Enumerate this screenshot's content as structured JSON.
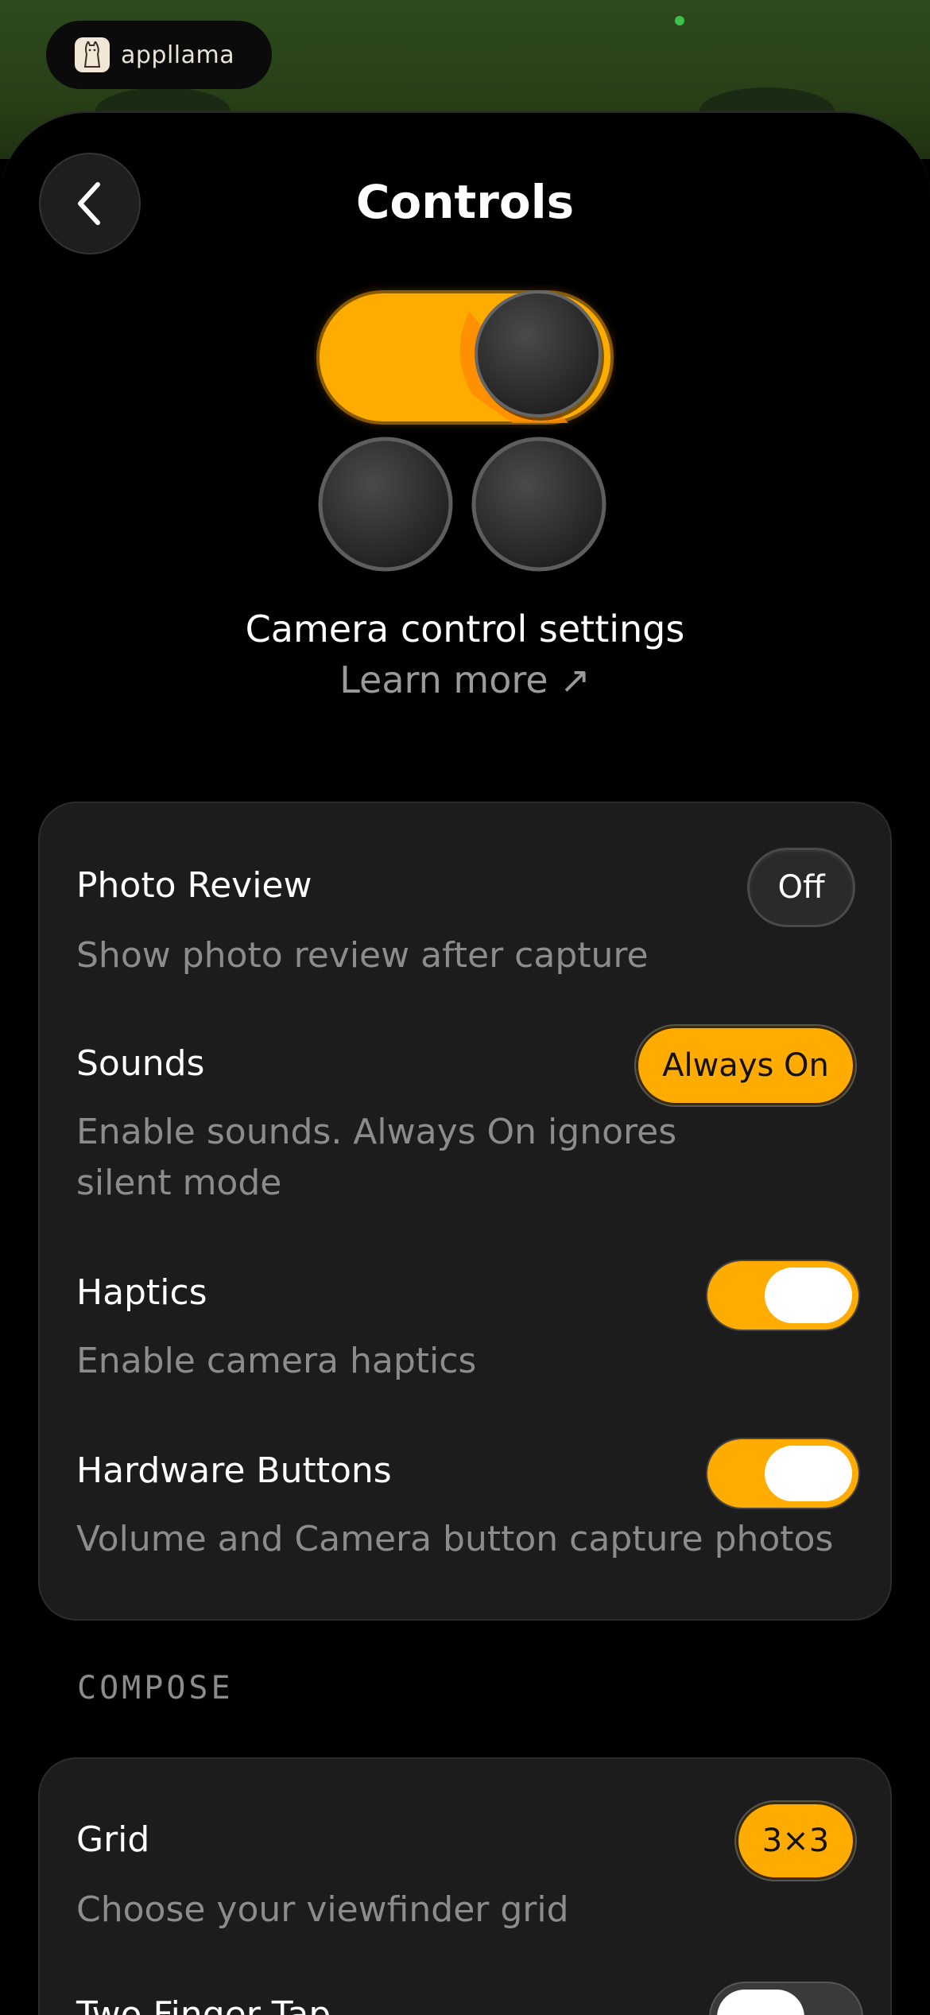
{
  "brand": {
    "name": "appllama"
  },
  "header": {
    "title": "Controls"
  },
  "hero": {
    "title": "Camera control settings",
    "link": "Learn more ↗"
  },
  "controls": [
    {
      "label": "Photo Review",
      "description": "Show photo review after capture",
      "control": "segment",
      "value": "Off",
      "active": false
    },
    {
      "label": "Sounds",
      "description": "Enable sounds. Always On ignores silent mode",
      "control": "segment",
      "value": "Always On",
      "active": true
    },
    {
      "label": "Haptics",
      "description": "Enable camera haptics",
      "control": "toggle",
      "on": true
    },
    {
      "label": "Hardware Buttons",
      "description": "Volume and Camera button capture photos",
      "control": "toggle",
      "on": true
    }
  ],
  "compose": {
    "section_label": "COMPOSE",
    "items": [
      {
        "label": "Grid",
        "description": "Choose your viewfinder grid",
        "control": "segment",
        "value": "3×3",
        "active": true
      },
      {
        "label": "Two Finger Tap",
        "control": "toggle",
        "on": false
      }
    ]
  },
  "colors": {
    "accent": "#ffab00",
    "card": "#1c1c1c",
    "background": "#000000",
    "header_green": "#2f4a1f"
  }
}
